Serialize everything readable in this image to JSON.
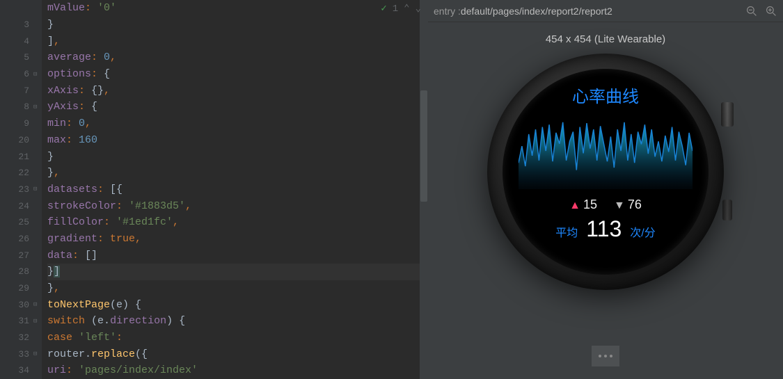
{
  "editor": {
    "top_annotation": {
      "check": "✓",
      "count": "1",
      "up": "⌃",
      "down": "⌄"
    },
    "lines": [
      {
        "n": "",
        "indent": 20,
        "tokens": [
          {
            "t": "mValue",
            "c": "tok-key"
          },
          {
            "t": ": ",
            "c": "tok-punct"
          },
          {
            "t": "'0'",
            "c": "tok-str"
          }
        ]
      },
      {
        "n": "3",
        "indent": 16,
        "tokens": [
          {
            "t": "}",
            "c": "tok-bracket"
          }
        ]
      },
      {
        "n": "4",
        "indent": 12,
        "tokens": [
          {
            "t": "]",
            "c": "tok-bracket"
          },
          {
            "t": ",",
            "c": "tok-punct"
          }
        ]
      },
      {
        "n": "5",
        "indent": 12,
        "tokens": [
          {
            "t": "average",
            "c": "tok-key"
          },
          {
            "t": ": ",
            "c": "tok-punct"
          },
          {
            "t": "0",
            "c": "tok-num"
          },
          {
            "t": ",",
            "c": "tok-punct"
          }
        ]
      },
      {
        "n": "6",
        "indent": 12,
        "tokens": [
          {
            "t": "options",
            "c": "tok-key"
          },
          {
            "t": ": ",
            "c": "tok-punct"
          },
          {
            "t": "{",
            "c": "tok-bracket"
          }
        ]
      },
      {
        "n": "7",
        "indent": 16,
        "tokens": [
          {
            "t": "xAxis",
            "c": "tok-key"
          },
          {
            "t": ": ",
            "c": "tok-punct"
          },
          {
            "t": "{}",
            "c": "tok-bracket"
          },
          {
            "t": ",",
            "c": "tok-punct"
          }
        ]
      },
      {
        "n": "8",
        "indent": 16,
        "tokens": [
          {
            "t": "yAxis",
            "c": "tok-key"
          },
          {
            "t": ": ",
            "c": "tok-punct"
          },
          {
            "t": "{",
            "c": "tok-bracket"
          }
        ]
      },
      {
        "n": "9",
        "indent": 20,
        "tokens": [
          {
            "t": "min",
            "c": "tok-key"
          },
          {
            "t": ": ",
            "c": "tok-punct"
          },
          {
            "t": "0",
            "c": "tok-num"
          },
          {
            "t": ",",
            "c": "tok-punct"
          }
        ]
      },
      {
        "n": "20",
        "indent": 20,
        "tokens": [
          {
            "t": "max",
            "c": "tok-key"
          },
          {
            "t": ": ",
            "c": "tok-punct"
          },
          {
            "t": "160",
            "c": "tok-num"
          }
        ]
      },
      {
        "n": "21",
        "indent": 16,
        "tokens": [
          {
            "t": "}",
            "c": "tok-bracket"
          }
        ]
      },
      {
        "n": "22",
        "indent": 12,
        "tokens": [
          {
            "t": "}",
            "c": "tok-bracket"
          },
          {
            "t": ",",
            "c": "tok-punct"
          }
        ]
      },
      {
        "n": "23",
        "indent": 12,
        "tokens": [
          {
            "t": "datasets",
            "c": "tok-key"
          },
          {
            "t": ": ",
            "c": "tok-punct"
          },
          {
            "t": "[",
            "c": "tok-bracket"
          },
          {
            "t": "{",
            "c": "tok-bracket"
          }
        ]
      },
      {
        "n": "24",
        "indent": 28,
        "marker": true,
        "tokens": [
          {
            "t": "strokeColor",
            "c": "tok-key"
          },
          {
            "t": ": ",
            "c": "tok-punct"
          },
          {
            "t": "'#1883d5'",
            "c": "tok-str"
          },
          {
            "t": ",",
            "c": "tok-punct"
          }
        ]
      },
      {
        "n": "25",
        "indent": 28,
        "marker": true,
        "tokens": [
          {
            "t": "fillColor",
            "c": "tok-key"
          },
          {
            "t": ": ",
            "c": "tok-punct"
          },
          {
            "t": "'#1ed1fc'",
            "c": "tok-str"
          },
          {
            "t": ",",
            "c": "tok-punct"
          }
        ]
      },
      {
        "n": "26",
        "indent": 28,
        "tokens": [
          {
            "t": "gradient",
            "c": "tok-key"
          },
          {
            "t": ": ",
            "c": "tok-punct"
          },
          {
            "t": "true",
            "c": "tok-kw"
          },
          {
            "t": ",",
            "c": "tok-punct"
          }
        ]
      },
      {
        "n": "27",
        "indent": 28,
        "tokens": [
          {
            "t": "data",
            "c": "tok-key"
          },
          {
            "t": ": ",
            "c": "tok-punct"
          },
          {
            "t": "[]",
            "c": "tok-bracket"
          }
        ]
      },
      {
        "n": "28",
        "indent": 24,
        "hl": true,
        "tokens": [
          {
            "t": "}",
            "c": "tok-bracket"
          },
          {
            "t": "]",
            "c": "tok-bracket mark-yellow"
          }
        ]
      },
      {
        "n": "29",
        "indent": 8,
        "tokens": [
          {
            "t": "}",
            "c": "tok-bracket"
          },
          {
            "t": ",",
            "c": "tok-punct"
          }
        ]
      },
      {
        "n": "30",
        "indent": 8,
        "tokens": [
          {
            "t": "toNextPage",
            "c": "tok-fn"
          },
          {
            "t": "(",
            "c": "tok-bracket"
          },
          {
            "t": "e",
            "c": "tok-default"
          },
          {
            "t": ") {",
            "c": "tok-bracket"
          }
        ]
      },
      {
        "n": "31",
        "indent": 12,
        "tokens": [
          {
            "t": "switch ",
            "c": "tok-kw"
          },
          {
            "t": "(",
            "c": "tok-bracket"
          },
          {
            "t": "e",
            "c": "tok-default"
          },
          {
            "t": ".",
            "c": "tok-default"
          },
          {
            "t": "direction",
            "c": "tok-key"
          },
          {
            "t": ") {",
            "c": "tok-bracket"
          }
        ]
      },
      {
        "n": "32",
        "indent": 16,
        "tokens": [
          {
            "t": "case ",
            "c": "tok-kw"
          },
          {
            "t": "'left'",
            "c": "tok-str"
          },
          {
            "t": ":",
            "c": "tok-punct"
          }
        ]
      },
      {
        "n": "33",
        "indent": 16,
        "tokens": [
          {
            "t": "router",
            "c": "tok-default"
          },
          {
            "t": ".",
            "c": "tok-default"
          },
          {
            "t": "replace",
            "c": "tok-method"
          },
          {
            "t": "({",
            "c": "tok-bracket"
          }
        ]
      },
      {
        "n": "34",
        "indent": 20,
        "tokens": [
          {
            "t": "uri",
            "c": "tok-key"
          },
          {
            "t": ": ",
            "c": "tok-punct"
          },
          {
            "t": "'pages/index/index'",
            "c": "tok-str"
          }
        ]
      }
    ]
  },
  "preview": {
    "entry_label": "entry : ",
    "entry_path": "default/pages/index/report2/report2",
    "dimensions": "454 x 454 (Lite Wearable)",
    "watch": {
      "title": "心率曲线",
      "high": "15",
      "low": "76",
      "avg_label": "平均",
      "avg_val": "113",
      "avg_unit": "次/分"
    }
  },
  "chart_data": {
    "type": "area",
    "title": "心率曲线",
    "ylim": [
      0,
      160
    ],
    "values": [
      55,
      90,
      48,
      115,
      70,
      125,
      60,
      130,
      80,
      135,
      58,
      118,
      95,
      140,
      60,
      100,
      120,
      40,
      130,
      75,
      138,
      85,
      125,
      60,
      132,
      95,
      58,
      110,
      45,
      125,
      80,
      140,
      60,
      115,
      55,
      120,
      94,
      135,
      74,
      125,
      68,
      100,
      58,
      112,
      78,
      130,
      60,
      120,
      90,
      50,
      118,
      80
    ]
  }
}
